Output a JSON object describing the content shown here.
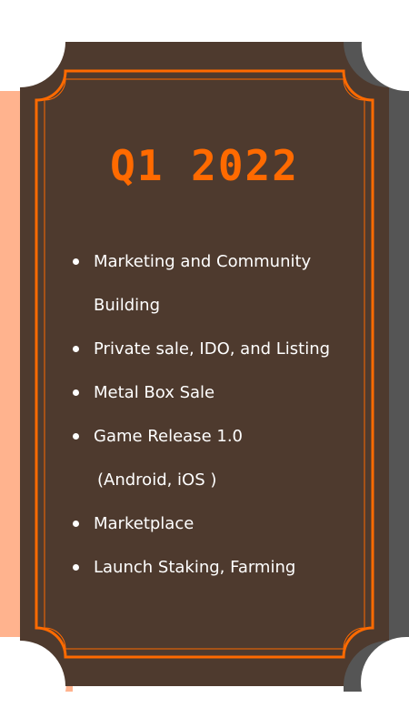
{
  "card": {
    "title": "Q1 2022",
    "items": [
      {
        "lines": [
          "Marketing and Community",
          "Building"
        ]
      },
      {
        "lines": [
          "Private sale, IDO, and Listing"
        ]
      },
      {
        "lines": [
          "Metal Box Sale"
        ]
      },
      {
        "lines": [
          "Game Release 1.0",
          "(Android, iOS )"
        ]
      },
      {
        "lines": [
          "Marketplace"
        ]
      },
      {
        "lines": [
          "Launch Staking, Farming"
        ]
      }
    ]
  },
  "colors": {
    "card_background": "#4e3a2e",
    "border_accent": "#ff6a00",
    "left_shadow": "#ffb38e",
    "right_shadow": "#555555",
    "text": "#ffffff"
  }
}
